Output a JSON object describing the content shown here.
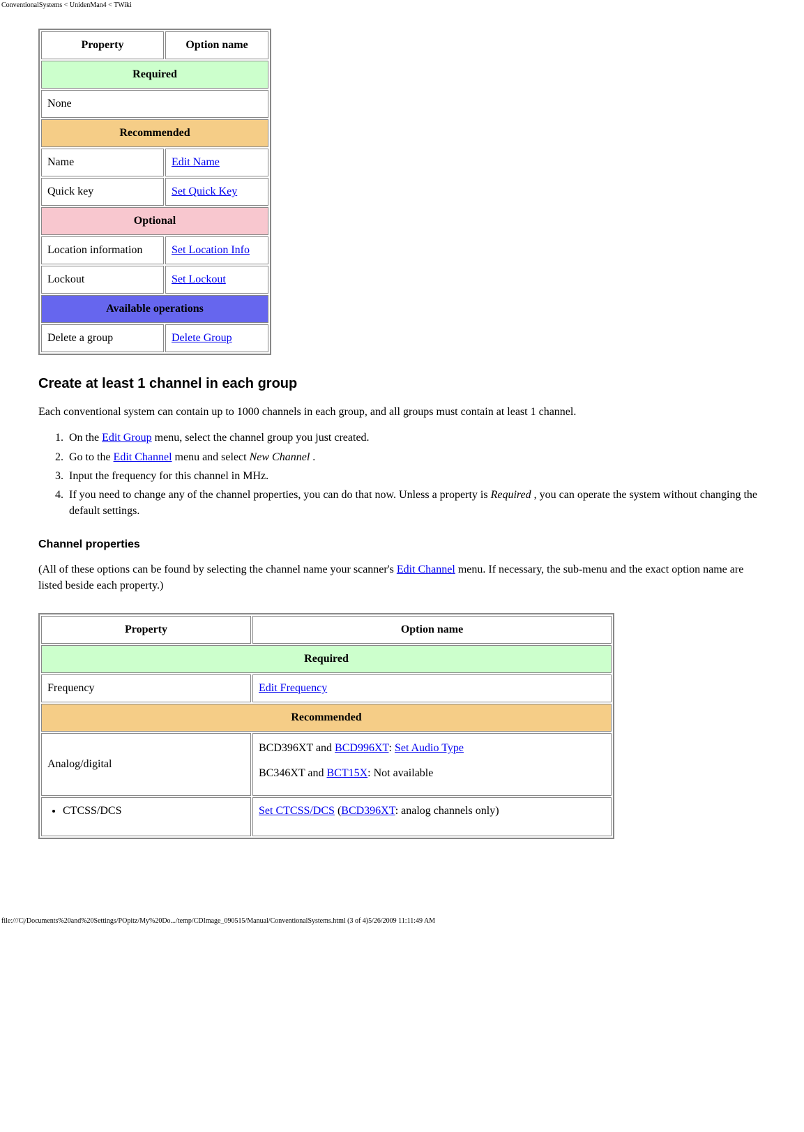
{
  "header_path": "ConventionalSystems < UnidenMan4 < TWiki",
  "footer_path": "file:///C|/Documents%20and%20Settings/POpitz/My%20Do.../temp/CDImage_090515/Manual/ConventionalSystems.html (3 of 4)5/26/2009 11:11:49 AM",
  "table1": {
    "headers": {
      "property": "Property",
      "option": "Option name"
    },
    "required_label": "Required",
    "required_rows": [
      {
        "property": "None"
      }
    ],
    "recommended_label": "Recommended",
    "recommended_rows": [
      {
        "property": "Name",
        "option_link": "Edit Name"
      },
      {
        "property": "Quick key",
        "option_link": "Set Quick Key"
      }
    ],
    "optional_label": "Optional",
    "optional_rows": [
      {
        "property": "Location information",
        "option_link": "Set Location Info"
      },
      {
        "property": "Lockout",
        "option_link": "Set Lockout"
      }
    ],
    "available_ops_label": "Available operations",
    "available_ops_rows": [
      {
        "property": "Delete a group",
        "option_link": "Delete Group"
      }
    ]
  },
  "section_heading": "Create at least 1 channel in each group",
  "intro_paragraph": "Each conventional system can contain up to 1000 channels in each group, and all groups must contain at least 1 channel.",
  "steps": {
    "s1_a": "On the ",
    "s1_link": "Edit Group",
    "s1_b": " menu, select the channel group you just created.",
    "s2_a": "Go to the ",
    "s2_link": "Edit Channel",
    "s2_b": " menu and select ",
    "s2_em": "New Channel",
    "s2_c": " .",
    "s3": "Input the frequency for this channel in MHz.",
    "s4_a": "If you need to change any of the channel properties, you can do that now. Unless a property is ",
    "s4_em": "Required",
    "s4_b": " , you can operate the system without changing the default settings."
  },
  "subsection_heading": "Channel properties",
  "subsection_paragraph_a": "(All of these options can be found by selecting the channel name your scanner's ",
  "subsection_link": "Edit Channel",
  "subsection_paragraph_b": " menu. If necessary, the sub-menu and the exact option name are listed beside each property.)",
  "table2": {
    "headers": {
      "property": "Property",
      "option": "Option name"
    },
    "required_label": "Required",
    "freq_row": {
      "property": "Frequency",
      "option_link": "Edit Frequency"
    },
    "recommended_label": "Recommended",
    "analog_row": {
      "property": "Analog/digital",
      "line1_a": "BCD396XT and ",
      "line1_link1": "BCD996XT",
      "line1_b": ": ",
      "line1_link2": "Set Audio Type",
      "line2_a": "BC346XT and ",
      "line2_link": "BCT15X",
      "line2_b": ": Not available"
    },
    "ctcss_row": {
      "property": "CTCSS/DCS",
      "link1": "Set CTCSS/DCS",
      "mid": " (",
      "link2": "BCD396XT",
      "tail": ": analog channels only)"
    }
  }
}
